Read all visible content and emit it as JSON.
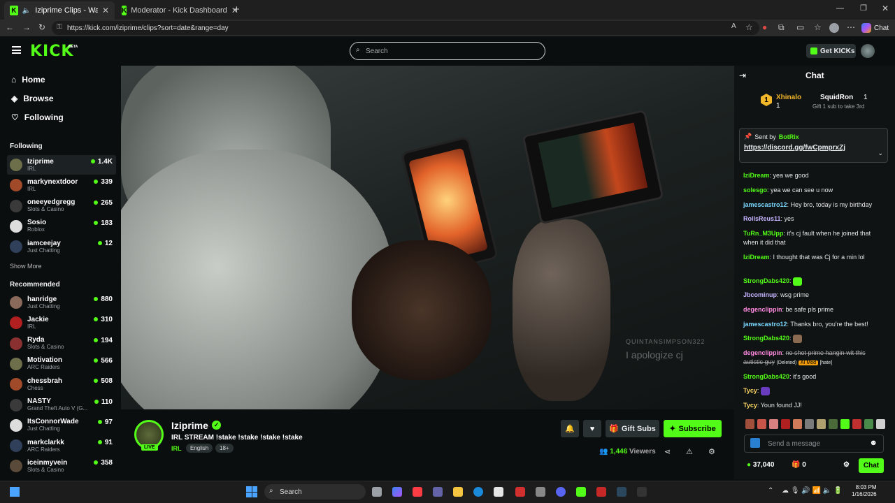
{
  "browser": {
    "tabs": [
      {
        "title": "Iziprime Clips - Watch Live on"
      },
      {
        "title": "Moderator - Kick Dashboard"
      }
    ],
    "url": "https://kick.com/iziprime/clips?sort=date&range=day",
    "copilot_label": "Chat"
  },
  "site": {
    "logo": "KICK",
    "beta": "BETA",
    "search_placeholder": "Search",
    "get_kicks": "Get KICKs"
  },
  "sidebar": {
    "nav": [
      {
        "label": "Home",
        "icon": "home-icon"
      },
      {
        "label": "Browse",
        "icon": "compass-icon"
      },
      {
        "label": "Following",
        "icon": "heart-icon"
      }
    ],
    "following_heading": "Following",
    "following": [
      {
        "name": "Iziprime",
        "category": "IRL",
        "viewers": "1.4K"
      },
      {
        "name": "markynextdoor",
        "category": "IRL",
        "viewers": "339"
      },
      {
        "name": "oneeyedgregg",
        "category": "Slots & Casino",
        "viewers": "265"
      },
      {
        "name": "Sosio",
        "category": "Roblox",
        "viewers": "183"
      },
      {
        "name": "iamceejay",
        "category": "Just Chatting",
        "viewers": "12"
      }
    ],
    "show_more": "Show More",
    "recommended_heading": "Recommended",
    "recommended": [
      {
        "name": "hanridge",
        "category": "Just Chatting",
        "viewers": "880"
      },
      {
        "name": "Jackie",
        "category": "IRL",
        "viewers": "310"
      },
      {
        "name": "Ryda",
        "category": "Slots & Casino",
        "viewers": "194"
      },
      {
        "name": "Motivation",
        "category": "ARC Raiders",
        "viewers": "566"
      },
      {
        "name": "chessbrah",
        "category": "Chess",
        "viewers": "508"
      },
      {
        "name": "NASTY",
        "category": "Grand Theft Auto V (G...",
        "viewers": "110"
      },
      {
        "name": "ItsConnorWade",
        "category": "Just Chatting",
        "viewers": "97"
      },
      {
        "name": "markclarkk",
        "category": "ARC Raiders",
        "viewers": "91"
      },
      {
        "name": "iceinmyvein",
        "category": "Slots & Casino",
        "viewers": "358"
      }
    ]
  },
  "video": {
    "watermark_user": "QUINTANSIMPSON322",
    "watermark_text": "I apologize cj"
  },
  "stream": {
    "name": "Iziprime",
    "live_badge": "LIVE",
    "title": "IRL STREAM !stake !stake !stake !stake",
    "category": "IRL",
    "tags": [
      "English",
      "18+"
    ],
    "gift_label": "Gift Subs",
    "subscribe_label": "Subscribe",
    "viewers": "1,446",
    "viewers_label": "Viewers"
  },
  "chat": {
    "title": "Chat",
    "leaderboard": [
      {
        "rank": "1",
        "name": "Xhinalo",
        "count": "1"
      },
      {
        "name": "SquidRon",
        "count": "1"
      }
    ],
    "gift_prompt": "Gift 1 sub to take 3rd",
    "pinned_sent_by": "Sent by",
    "pinned_user": "BotRix",
    "pinned_link": "https://discord.gg/fwCpmprxZj",
    "messages": [
      {
        "user": "IziDream",
        "text": "yea we good",
        "color": "#53fc18"
      },
      {
        "user": "solesgo",
        "text": "yea we can see u now",
        "color": "#53fc18"
      },
      {
        "user": "jamescastro12",
        "text": "Hey bro, today is my birthday",
        "color": "#7cd9ff"
      },
      {
        "user": "RollsReus11",
        "text": "yes",
        "color": "#c6b3ff"
      },
      {
        "user": "TuRn_M3Upp",
        "text": "it's cj fault when he joined that when it did that",
        "color": "#53fc18"
      },
      {
        "user": "IziDream",
        "text": "I thought that was Cj for a min lol",
        "color": "#53fc18"
      },
      {
        "user": "StrongDabs420",
        "text": "",
        "color": "#53fc18"
      },
      {
        "user": "Jbcominup",
        "text": "wsg prime",
        "color": "#c6b3ff"
      },
      {
        "user": "degenclippin",
        "text": "be safe pls prime",
        "color": "#ff8adf"
      },
      {
        "user": "jamescastro12",
        "text": "Thanks bro, you're the best!",
        "color": "#7cd9ff"
      },
      {
        "user": "StrongDabs420",
        "text": "",
        "color": "#53fc18"
      },
      {
        "user": "degenclippin",
        "text": "no shot prime hangin wit this autistic guy",
        "color": "#ff8adf"
      },
      {
        "user": "StrongDabs420",
        "text": "it's good",
        "color": "#53fc18"
      },
      {
        "user": "Tycy",
        "text": "",
        "color": "#ffd966"
      },
      {
        "user": "Tycy",
        "text": "Youn found JJ!",
        "color": "#ffd966"
      }
    ],
    "deleted_label": "(Deleted)",
    "ai_mod_label": "AI Mod",
    "hate_label": "[hate]",
    "input_placeholder": "Send a message",
    "points": "37,040",
    "gifts": "0",
    "send_label": "Chat"
  },
  "taskbar": {
    "search": "Search",
    "time": "8:03 PM",
    "date": "1/16/2026"
  }
}
